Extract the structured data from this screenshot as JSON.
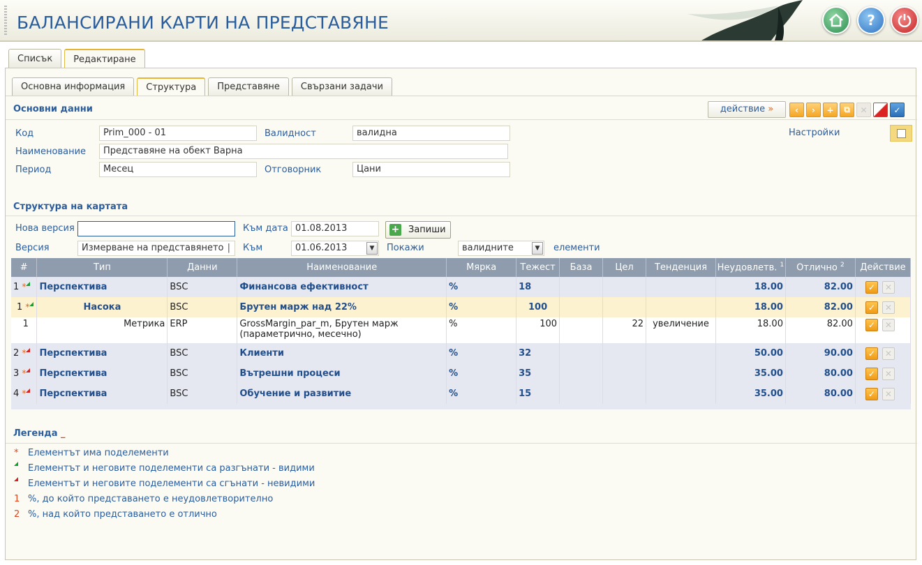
{
  "app": {
    "title": "БАЛАНСИРАНИ КАРТИ НА ПРЕДСТАВЯНЕ"
  },
  "tabs_top": [
    {
      "label": "Списък"
    },
    {
      "label": "Редактиране"
    }
  ],
  "tabs_sub": [
    {
      "label": "Основна информация"
    },
    {
      "label": "Структура"
    },
    {
      "label": "Представяне"
    },
    {
      "label": "Свързани задачи"
    }
  ],
  "basic": {
    "section_title": "Основни данни",
    "action_label": "действие",
    "settings_label": "Настройки",
    "code_label": "Код",
    "code_value": "Prim_000 - 01",
    "validity_label": "Валидност",
    "validity_value": "валидна",
    "name_label": "Наименование",
    "name_value": "Представяне на обект Варна",
    "period_label": "Период",
    "period_value": "Месец",
    "responsible_label": "Отговорник",
    "responsible_value": "Цани"
  },
  "structure": {
    "section_title": "Структура на картата",
    "new_version_label": "Нова версия",
    "new_version_value": "",
    "to_date_label": "Към дата",
    "to_date_value": "01.08.2013",
    "save_label": "Запиши",
    "version_label": "Версия",
    "version_value": "Измерване на представянето",
    "to_label": "Към",
    "to_value": "01.06.2013",
    "show_label": "Покажи",
    "show_value": "валидните",
    "elements_label": "елементи"
  },
  "table": {
    "headers": {
      "num": "#",
      "type": "Тип",
      "data": "Данни",
      "name": "Наименование",
      "unit": "Мярка",
      "weight": "Тежест",
      "base": "База",
      "target": "Цел",
      "trend": "Тенденция",
      "unsat": "Неудовлетв.",
      "unsat_sup": "1",
      "excel": "Отлично",
      "excel_sup": "2",
      "action": "Действие"
    },
    "rows": [
      {
        "num": "1",
        "star": "*",
        "type": "Перспектива",
        "data": "BSC",
        "name": "Финансова ефективност",
        "unit": "%",
        "weight": "18",
        "base": "",
        "target": "",
        "trend": "",
        "unsat": "18.00",
        "excel": "82.00"
      },
      {
        "num": "1",
        "star": "*",
        "type": "Насока",
        "data": "BSC",
        "name": "Брутен марж над 22%",
        "unit": "%",
        "weight": "100",
        "base": "",
        "target": "",
        "trend": "",
        "unsat": "18.00",
        "excel": "82.00"
      },
      {
        "num": "1",
        "star": "",
        "type": "Метрика",
        "data": "ERP",
        "name": "GrossMargin_par_m, Брутен марж (параметрично, месечно)",
        "unit": "%",
        "weight": "100",
        "base": "",
        "target": "22",
        "trend": "увеличение",
        "unsat": "18.00",
        "excel": "82.00"
      },
      {
        "num": "2",
        "star": "*",
        "type": "Перспектива",
        "data": "BSC",
        "name": "Клиенти",
        "unit": "%",
        "weight": "32",
        "base": "",
        "target": "",
        "trend": "",
        "unsat": "50.00",
        "excel": "90.00"
      },
      {
        "num": "3",
        "star": "*",
        "type": "Перспектива",
        "data": "BSC",
        "name": "Вътрешни процеси",
        "unit": "%",
        "weight": "35",
        "base": "",
        "target": "",
        "trend": "",
        "unsat": "35.00",
        "excel": "80.00"
      },
      {
        "num": "4",
        "star": "*",
        "type": "Перспектива",
        "data": "BSC",
        "name": "Обучение и развитие",
        "unit": "%",
        "weight": "15",
        "base": "",
        "target": "",
        "trend": "",
        "unsat": "35.00",
        "excel": "80.00"
      }
    ]
  },
  "legend": {
    "title": "Легенда",
    "items": [
      {
        "mark": "*",
        "text": "Елементът има поделементи"
      },
      {
        "mark": "",
        "text": "Елементът и неговите поделементи са разгънати - видими"
      },
      {
        "mark": "",
        "text": "Елементът и неговите поделементи са сгънати - невидими"
      },
      {
        "mark": "1",
        "text": "%, до който представането е неудовлетворително"
      },
      {
        "mark": "2",
        "text": "%, над който представането е отлично"
      }
    ]
  },
  "colors": {
    "accent": "#2a5d9e",
    "header_bg": "#8e9cae",
    "highlight": "#fcf2d0"
  },
  "icons": [
    "home-icon",
    "help-icon",
    "power-icon",
    "checkbox-icon",
    "calendar-icon"
  ]
}
